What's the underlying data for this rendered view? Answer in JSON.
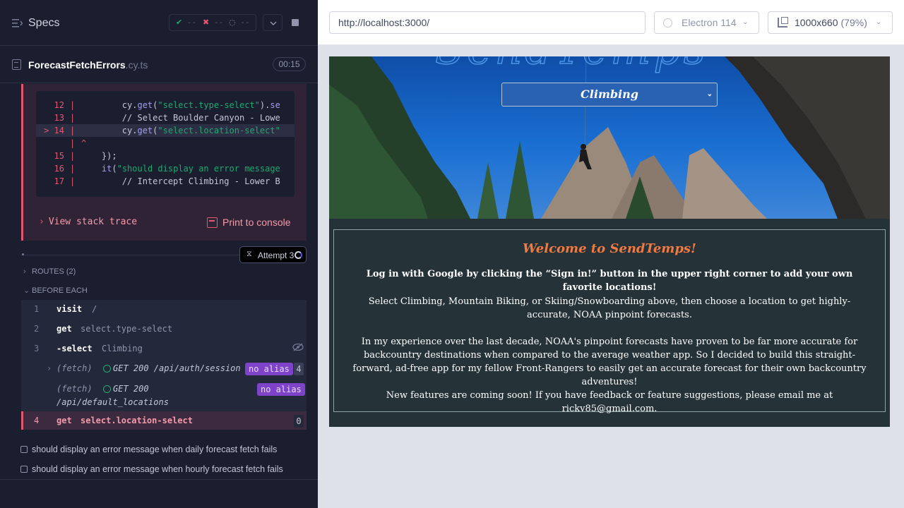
{
  "reporter": {
    "title": "Specs",
    "stats": {
      "passed": "--",
      "failed": "--",
      "pending": "--"
    },
    "file": {
      "name": "ForecastFetchErrors",
      "ext": ".cy.ts",
      "duration": "00:15"
    },
    "code_frame": [
      {
        "ln": "12",
        "code": "        cy.get(\"select.type-select\").se"
      },
      {
        "ln": "13",
        "code": "        // Select Boulder Canyon - Lowe"
      },
      {
        "ln": "> 14",
        "code": "        cy.get(\"select.location-select\""
      },
      {
        "ln": "",
        "code": "^"
      },
      {
        "ln": "15",
        "code": "    });"
      },
      {
        "ln": "16",
        "code": "    it(\"should display an error message"
      },
      {
        "ln": "17",
        "code": "        // Intercept Climbing - Lower B"
      }
    ],
    "view_stack_trace": "View stack trace",
    "print_to_console": "Print to console",
    "attempt": "Attempt 3",
    "routes_label": "ROUTES (2)",
    "before_each_label": "BEFORE EACH",
    "commands": [
      {
        "num": "1",
        "name": "visit",
        "message": "/"
      },
      {
        "num": "2",
        "name": "get",
        "message": "select.type-select"
      },
      {
        "num": "3",
        "name": "-select",
        "message": "Climbing"
      },
      {
        "num": "4",
        "name": "get",
        "message": "select.location-select",
        "count": "0"
      }
    ],
    "fetches": [
      {
        "label": "(fetch)",
        "text": "GET 200 /api/auth/session",
        "alias": "no alias",
        "count": "4"
      },
      {
        "label": "(fetch)",
        "text": "GET 200",
        "text2": "/api/default_locations",
        "alias": "no alias"
      }
    ],
    "tests": [
      "should display an error message when daily forecast fetch fails",
      "should display an error message when hourly forecast fetch fails"
    ]
  },
  "aut": {
    "url": "http://localhost:3000/",
    "browser": "Electron 114",
    "viewport": "1000x660",
    "zoom": "(79%)",
    "app": {
      "selected_type": "Climbing",
      "welcome_title": "Welcome to SendTemps!",
      "p1": "Log in with Google by clicking the “Sign in!” button in the upper right corner to add your own favorite locations!",
      "p2": "Select Climbing, Mountain Biking, or Skiing/Snowboarding above, then choose a location to get highly-accurate, NOAA pinpoint forecasts.",
      "p3": "In my experience over the last decade, NOAA's pinpoint forecasts have proven to be far more accurate for backcountry destinations when compared to the average weather app. So I decided to build this straight-forward, ad-free app for my fellow Front-Rangers to easily get an accurate forecast for their own backcountry adventures!",
      "p4": "New features are coming soon! If you have feedback or feature suggestions, please email me at rickv85@gmail.com."
    }
  },
  "colors": {
    "reporter_bg": "#1b1e2e",
    "error_red": "#e45770",
    "pass_green": "#1fa971",
    "alias_purple": "#7f43c9",
    "welcome_orange": "#ef7a42",
    "app_bg": "#253238"
  },
  "icons": [
    "menu-icon",
    "check-icon",
    "x-icon",
    "spinner-icon",
    "chevron-down-icon",
    "stop-icon",
    "file-icon",
    "print-icon",
    "attempt-icon",
    "eye-slash-icon",
    "electron-icon",
    "ruler-icon"
  ]
}
